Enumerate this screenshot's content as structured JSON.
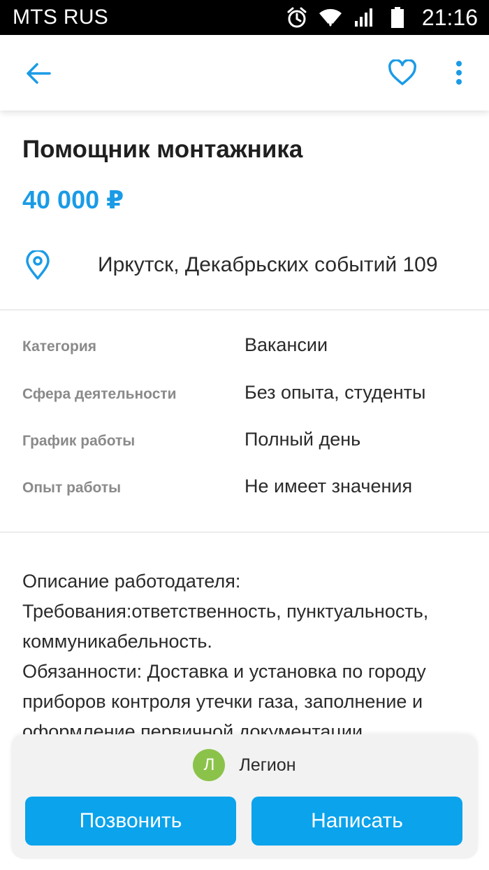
{
  "status_bar": {
    "carrier": "MTS RUS",
    "time": "21:16",
    "icons": [
      "alarm-icon",
      "wifi-icon",
      "signal-icon",
      "battery-icon"
    ]
  },
  "app_bar": {
    "icons": [
      "back-arrow-icon",
      "heart-icon",
      "more-vertical-icon"
    ],
    "accent_color": "#1a9be6"
  },
  "listing": {
    "title": "Помощник монтажника",
    "price": "40 000 ₽",
    "address": "Иркутск, Декабрьских событий 109"
  },
  "params": [
    {
      "label": "Категория",
      "value": "Вакансии"
    },
    {
      "label": "Сфера деятельности",
      "value": "Без опыта, студенты"
    },
    {
      "label": "График работы",
      "value": "Полный день"
    },
    {
      "label": "Опыт работы",
      "value": "Не имеет значения"
    }
  ],
  "description": [
    "Описание работодателя:",
    "Требования:ответственность, пунктуальность,",
    "коммуникабельность.",
    "Обязанности: Доставка и установка по городу",
    "приборов контроля утечки газа, заполнение и",
    "оформление первичной документации."
  ],
  "contact": {
    "avatar_letter": "Л",
    "seller_name": "Легион",
    "avatar_color": "#8bc34a",
    "call_label": "Позвонить",
    "write_label": "Написать",
    "button_color": "#0aa3ec"
  }
}
